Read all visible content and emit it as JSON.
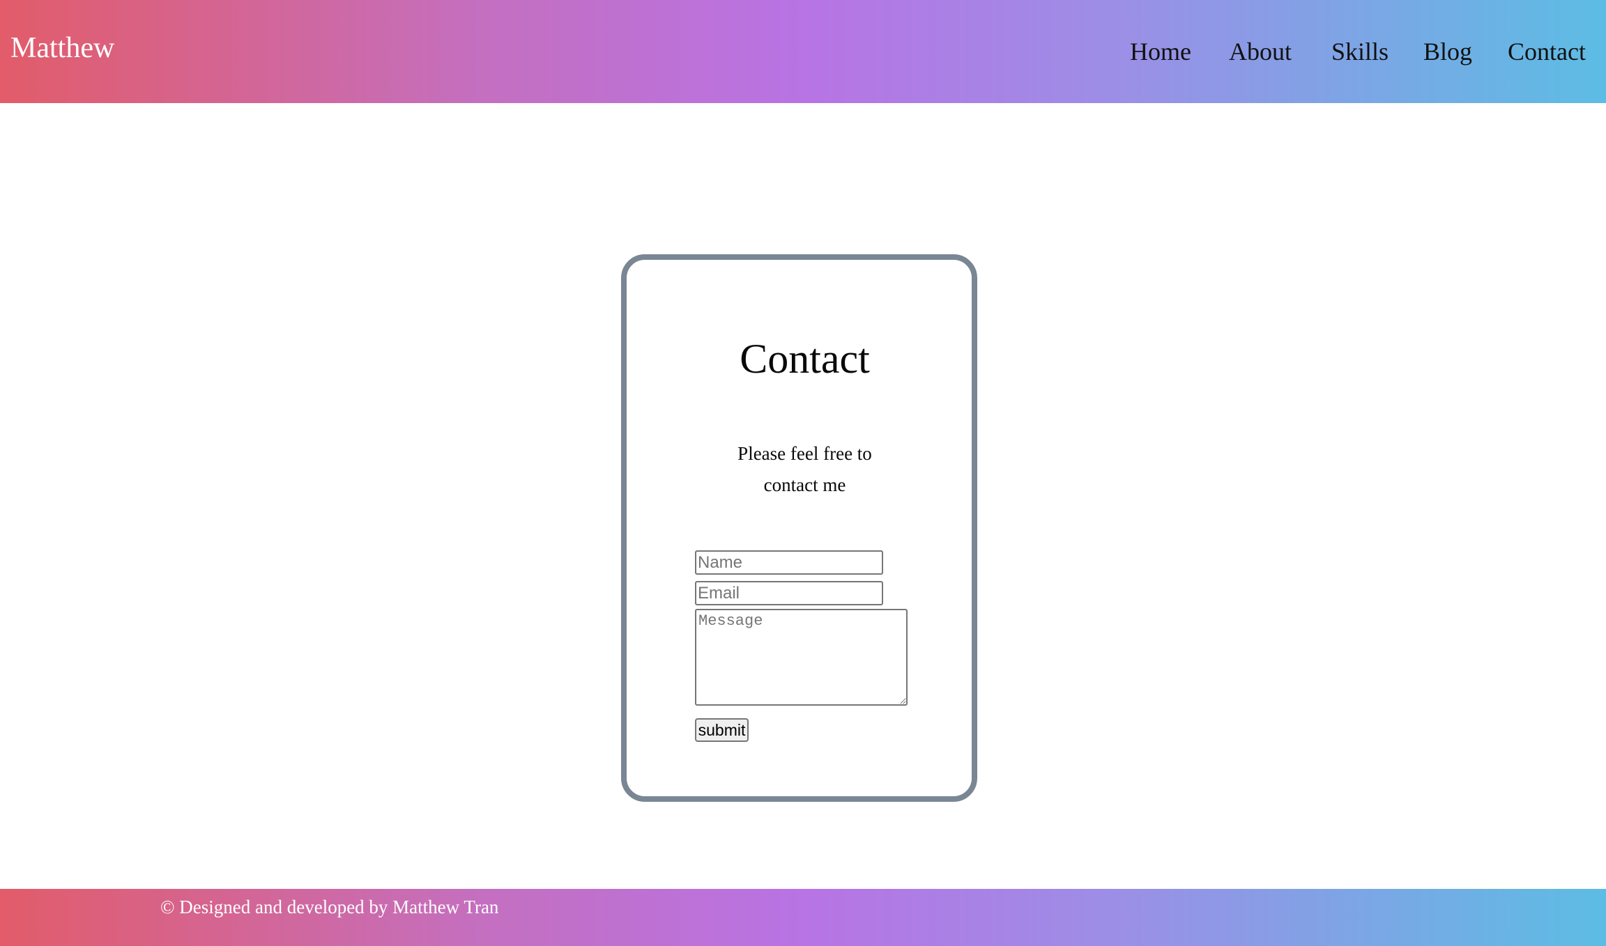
{
  "header": {
    "brand": "Matthew",
    "nav": [
      {
        "label": "Home"
      },
      {
        "label": "About"
      },
      {
        "label": "Skills"
      },
      {
        "label": "Blog"
      },
      {
        "label": "Contact"
      }
    ]
  },
  "contact_card": {
    "title": "Contact",
    "subtitle": "Please feel free to contact me",
    "name_placeholder": "Name",
    "email_placeholder": "Email",
    "message_placeholder": "Message",
    "submit_label": "submit"
  },
  "footer": {
    "text": "© Designed and developed by Matthew Tran"
  },
  "colors": {
    "gradient_start": "#e25c6a",
    "gradient_mid": "#b873e4",
    "gradient_end": "#5cbde4",
    "card_border": "#7a8694"
  }
}
